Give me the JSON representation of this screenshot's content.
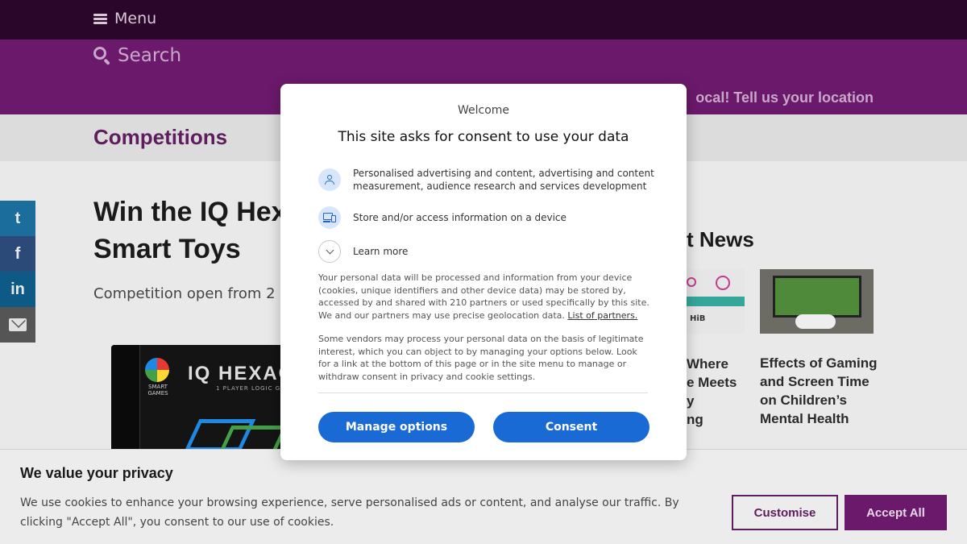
{
  "header": {
    "menu_label": "Menu",
    "search_label": "Search",
    "location_prompt": "ocal! Tell us your location"
  },
  "section": {
    "title": "Competitions"
  },
  "share": {
    "twitter": "t",
    "facebook": "f",
    "linkedin": "in"
  },
  "article": {
    "title_line1": "Win the IQ Hex",
    "title_line2": "Smart Toys",
    "open_text": "Competition open from 2 ",
    "product": {
      "brand": "IQ HEXAG",
      "maker": "SMART GAMES",
      "tagline": "1 PLAYER LOGIC GAM"
    }
  },
  "latest": {
    "heading": "t News",
    "cut_title_lines": [
      "Where",
      "e Meets",
      "y",
      "ng"
    ],
    "thumb_text": "HiB",
    "item2_title": "Effects of Gaming and Screen Time on Children’s Mental Health"
  },
  "cookie_banner": {
    "title": "We value your privacy",
    "text": "We use cookies to enhance your browsing experience, serve personalised ads or content, and analyse our traffic. By clicking \"Accept All\", you consent to our use of cookies.",
    "customise_label": "Customise",
    "accept_all_label": "Accept All"
  },
  "consent_modal": {
    "welcome": "Welcome",
    "heading": "This site asks for consent to use your data",
    "purposes": [
      {
        "icon": "person-icon",
        "text": "Personalised advertising and content, advertising and content measurement, audience research and services development"
      },
      {
        "icon": "device-icon",
        "text": "Store and/or access information on a device"
      }
    ],
    "learn_more": "Learn more",
    "para1": "Your personal data will be processed and information from your device (cookies, unique identifiers and other device data) may be stored by, accessed by and shared with 210 partners or used specifically by this site. We and our partners may use precise geolocation data. ",
    "partners_link": "List of partners.",
    "para2": "Some vendors may process your personal data on the basis of legitimate interest, which you can object to by managing your options below. Look for a link at the bottom of this page or in the site menu to manage or withdraw consent in privacy and cookie settings.",
    "manage_label": "Manage options",
    "consent_label": "Consent"
  },
  "colors": {
    "topbar": "#2a062a",
    "brand_purple": "#6b196b",
    "consent_blue": "#1a6ad6"
  }
}
